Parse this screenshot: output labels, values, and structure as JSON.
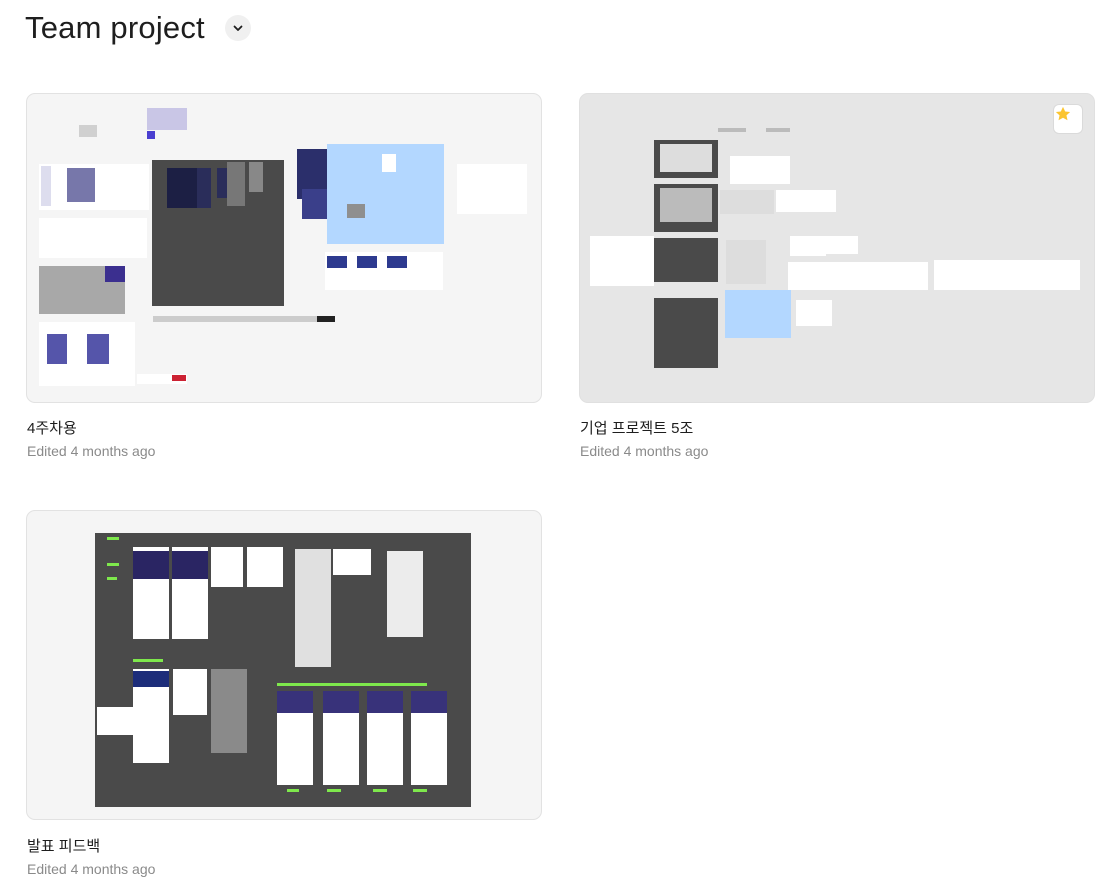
{
  "header": {
    "title": "Team project",
    "menu_icon": "chevron-down-icon"
  },
  "files": [
    {
      "name": "4주차용",
      "edited": "Edited 4 months ago",
      "starred": false
    },
    {
      "name": "기업 프로젝트 5조",
      "edited": "Edited 4 months ago",
      "starred": true,
      "star_color": "#fbc531"
    },
    {
      "name": "발표 피드백",
      "edited": "Edited 4 months ago",
      "starred": false
    }
  ],
  "colors": {
    "canvas_dark": "#4a4a4a",
    "canvas_blue": "#b3d7ff",
    "annotation_green": "#7ee84c"
  }
}
